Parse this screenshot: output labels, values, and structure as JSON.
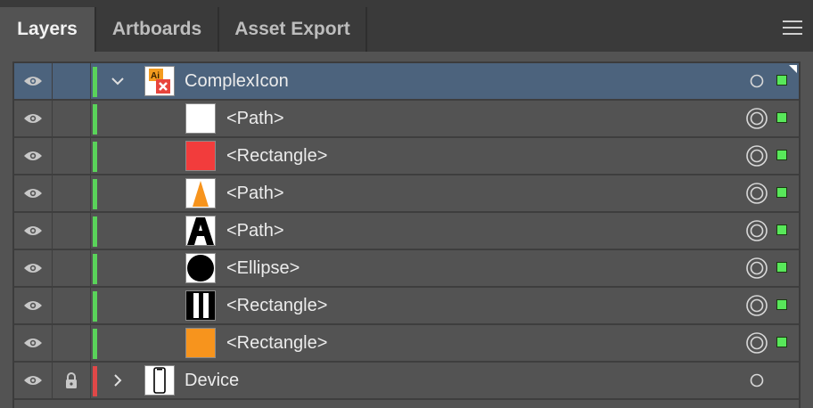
{
  "tabs": [
    {
      "label": "Layers",
      "active": true
    },
    {
      "label": "Artboards",
      "active": false
    },
    {
      "label": "Asset Export",
      "active": false
    }
  ],
  "menu_icon": "hamburger-menu-icon",
  "colors": {
    "layer_complexicon": "#5ad35a",
    "layer_device": "#e04848",
    "selection_highlight": "#4c637d",
    "selected_art_indicator": "#58e85a"
  },
  "layers": [
    {
      "name": "ComplexIcon",
      "kind": "layer",
      "expanded": true,
      "selected": true,
      "locked": false,
      "thumbnail": "ai-file-icon"
    },
    {
      "name": "<Path>",
      "kind": "object",
      "thumbnail": "white-square"
    },
    {
      "name": "<Rectangle>",
      "kind": "object",
      "thumbnail": "red-square"
    },
    {
      "name": "<Path>",
      "kind": "object",
      "thumbnail": "orange-triangle"
    },
    {
      "name": "<Path>",
      "kind": "object",
      "thumbnail": "black-a-shape"
    },
    {
      "name": "<Ellipse>",
      "kind": "object",
      "thumbnail": "black-circle"
    },
    {
      "name": "<Rectangle>",
      "kind": "object",
      "thumbnail": "black-white-bars"
    },
    {
      "name": "<Rectangle>",
      "kind": "object",
      "thumbnail": "orange-square"
    },
    {
      "name": "Device",
      "kind": "layer",
      "expanded": false,
      "selected": false,
      "locked": true,
      "thumbnail": "phone-icon"
    }
  ]
}
